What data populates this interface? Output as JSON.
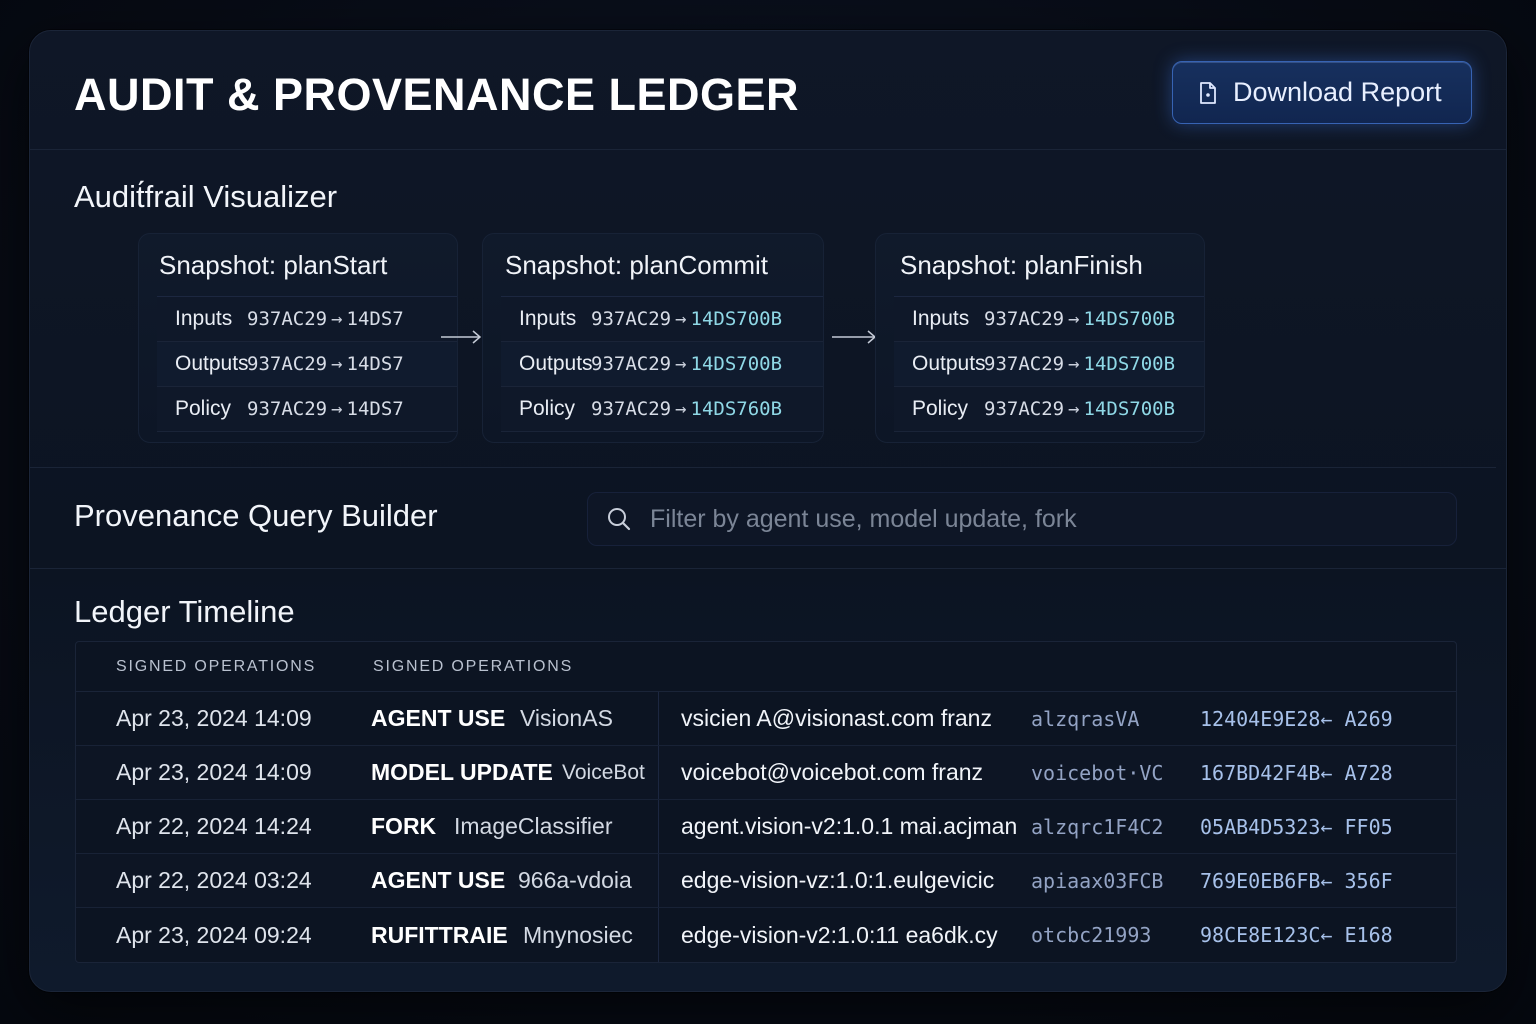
{
  "header": {
    "title": "AUDIT & PROVENANCE LEDGER",
    "download_label": "Download Report",
    "download_icon": "document-icon"
  },
  "audit_trail": {
    "title": "Audit́frail Visualizer",
    "snapshots": [
      {
        "title": "Snapshot: planStart",
        "rows": [
          {
            "key": "Inputs",
            "from": "937AC29",
            "arrow": "→",
            "to": "14DS7"
          },
          {
            "key": "Outputs",
            "from": "937AC29",
            "arrow": "→",
            "to": "14DS7"
          },
          {
            "key": "Policy",
            "from": "937AC29",
            "arrow": "→",
            "to": "14DS7"
          }
        ]
      },
      {
        "title": "Snapshot: planCommit",
        "rows": [
          {
            "key": "Inputs",
            "from": "937AC29",
            "arrow": "→",
            "to": "14DS700B"
          },
          {
            "key": "Outputs",
            "from": "937AC29",
            "arrow": "→",
            "to": "14DS700B"
          },
          {
            "key": "Policy",
            "from": "937AC29",
            "arrow": "→",
            "to": "14DS760B"
          }
        ]
      },
      {
        "title": "Snapshot: planFinish",
        "rows": [
          {
            "key": "Inputs",
            "from": "937AC29",
            "arrow": "→",
            "to": "14DS700B"
          },
          {
            "key": "Outputs",
            "from": "937AC29",
            "arrow": "→",
            "to": "14DS700B"
          },
          {
            "key": "Policy",
            "from": "937AC29",
            "arrow": "→",
            "to": "14DS700B"
          }
        ]
      }
    ]
  },
  "query_builder": {
    "title": "Provenance Query Builder",
    "search_placeholder": "Filter by agent use, model update, fork",
    "search_value": ""
  },
  "ledger": {
    "title": "Ledger Timeline",
    "headers": [
      "SIGNED OPERATIONS",
      "SIGNED OPERATIONS"
    ],
    "rows": [
      {
        "date": "Apr 23, 2024  14:09",
        "op": "AGENT USE",
        "agent": "VisionAS",
        "signer": "vsicien A@visionast.com franz",
        "key": "alzqrasVA",
        "hash": "12404E9E28← A269"
      },
      {
        "date": "Apr 23, 2024  14:09",
        "op": "MODEL UPDATE",
        "agent": "VoiceBot",
        "signer": "voicebot@voicebot.com franz",
        "key": "voicebot·VC",
        "hash": "167BD42F4B← A728"
      },
      {
        "date": "Apr 22, 2024  14:24",
        "op": "FORK",
        "agent": "ImageClassifier",
        "signer": "agent.vision-v2:1.0.1 mai.acjman",
        "key": "alzqrc1F4C2",
        "hash": "05AB4D5323← FF05"
      },
      {
        "date": "Apr 22, 2024  03:24",
        "op": "AGENT USE",
        "agent": "966a-vdoia",
        "signer": "edge-vision-vz:1.0:1.eulgevicic",
        "key": "apiaax03FCB",
        "hash": "769E0EB6FB← 356F"
      },
      {
        "date": "Apr 23, 2024  09:24",
        "op": "RUFITTRAIE",
        "agent": "Mnynosiec",
        "signer": "edge-vision-v2:1.0:11  ea6dk.cy",
        "key": "otcbc21993",
        "hash": "98CE8E123C← E168"
      }
    ]
  },
  "colors": {
    "accent": "#3763b3",
    "hash_to": "#8fd8e6",
    "background": "#070b14"
  }
}
